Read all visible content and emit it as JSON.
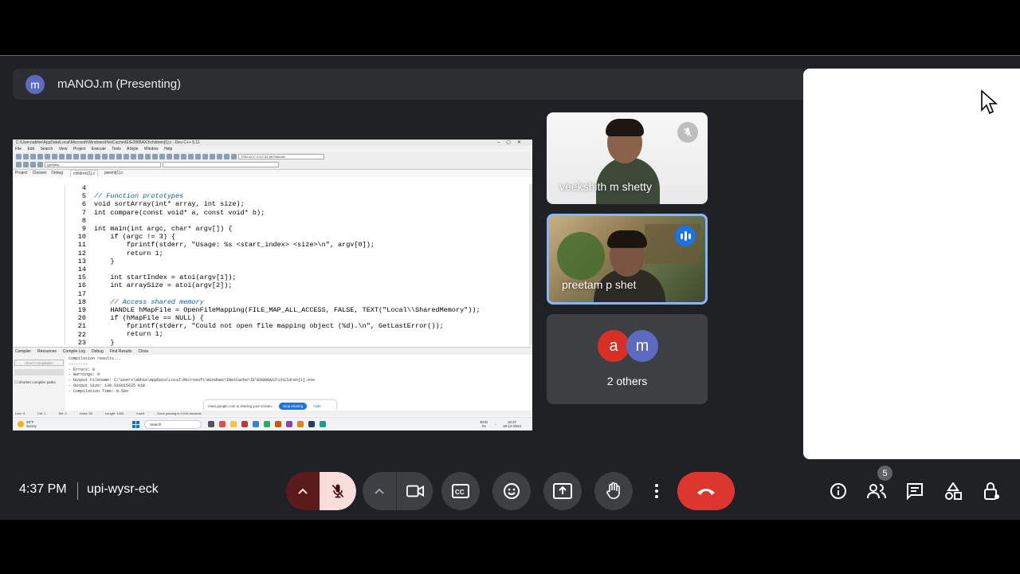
{
  "presenter": {
    "avatar_letter": "m",
    "label": "mANOJ.m (Presenting)"
  },
  "shared_screen": {
    "window_title": "C:\\Users\\abhie\\AppData\\Local\\Microsoft\\Windows\\INetCache\\IE\\E0888AX3\\children[1].c - Dev-C++ 5.11",
    "menu": [
      "File",
      "Edit",
      "Search",
      "View",
      "Project",
      "Execute",
      "Tools",
      "AStyle",
      "Window",
      "Help"
    ],
    "compiler_select": "TDM-GCC 4.9.2 64-bit Release",
    "globals_select": "(globals)",
    "left_tabs": [
      "Project",
      "Classes",
      "Debug"
    ],
    "file_tabs": [
      "children[1].c",
      "parent[1].c"
    ],
    "line_numbers": [
      "4",
      "5",
      "6",
      "7",
      "8",
      "9",
      "10",
      "11",
      "12",
      "13",
      "14",
      "15",
      "16",
      "17",
      "18",
      "19",
      "20",
      "21",
      "22",
      "23"
    ],
    "code_lines": [
      "",
      "// Function prototypes",
      "void sortArray(int* array, int size);",
      "int compare(const void* a, const void* b);",
      "",
      "int main(int argc, char* argv[]) {",
      "    if (argc != 3) {",
      "        fprintf(stderr, \"Usage: %s <start_index> <size>\\n\", argv[0]);",
      "        return 1;",
      "    }",
      "",
      "    int startIndex = atoi(argv[1]);",
      "    int arraySize = atoi(argv[2]);",
      "",
      "    // Access shared memory",
      "    HANDLE hMapFile = OpenFileMapping(FILE_MAP_ALL_ACCESS, FALSE, TEXT(\"Local\\\\SharedMemory\"));",
      "    if (hMapFile == NULL) {",
      "        fprintf(stderr, \"Could not open file mapping object (%d).\\n\", GetLastError());",
      "        return 1;",
      "    }"
    ],
    "lower_tabs": [
      "Compiler",
      "Resources",
      "Compile Log",
      "Debug",
      "Find Results",
      "Close"
    ],
    "abort_label": "Abort Compilation",
    "shorten_label": "Shorten compiler paths",
    "compile_log": "Compilation results...\n--------\n- Errors: 0\n- Warnings: 0\n- Output Filename: C:\\Users\\abhie\\AppData\\Local\\Microsoft\\Windows\\INetCache\\IE\\E0888AX3\\children[1].exe\n- Output Size: 130.916015625 KiB\n- Compilation Time: 0.50s",
    "status": [
      "Line: 3",
      "Col: 1",
      "Sel: 0",
      "Lines: 53",
      "Length: 1400",
      "Insert",
      "Done parsing in 0.016 seconds"
    ],
    "sharing_notice": "meet.google.com is sharing your screen.",
    "stop_sharing": "Stop sharing",
    "hide": "Hide",
    "weather_temp": "89°F",
    "weather_desc": "Sunny",
    "taskbar_search": "Search",
    "tray_lang": "ENG",
    "tray_region": "IN",
    "tray_time": "16:37",
    "tray_date": "15-12-2024"
  },
  "participants": [
    {
      "name": "veekshith m shetty",
      "muted": true
    },
    {
      "name": "preetam p shet",
      "speaking": true
    }
  ],
  "others": {
    "letters": [
      "a",
      "m"
    ],
    "colors": [
      "#d93025",
      "#5c6bc0"
    ],
    "label": "2 others"
  },
  "footer": {
    "time": "4:37 PM",
    "meeting_code": "upi-wysr-eck",
    "people_count": "5"
  },
  "colors": {
    "end_call": "#dc362e",
    "mic_muted_bg": "#f9dedc",
    "speaking": "#1a73e8"
  }
}
